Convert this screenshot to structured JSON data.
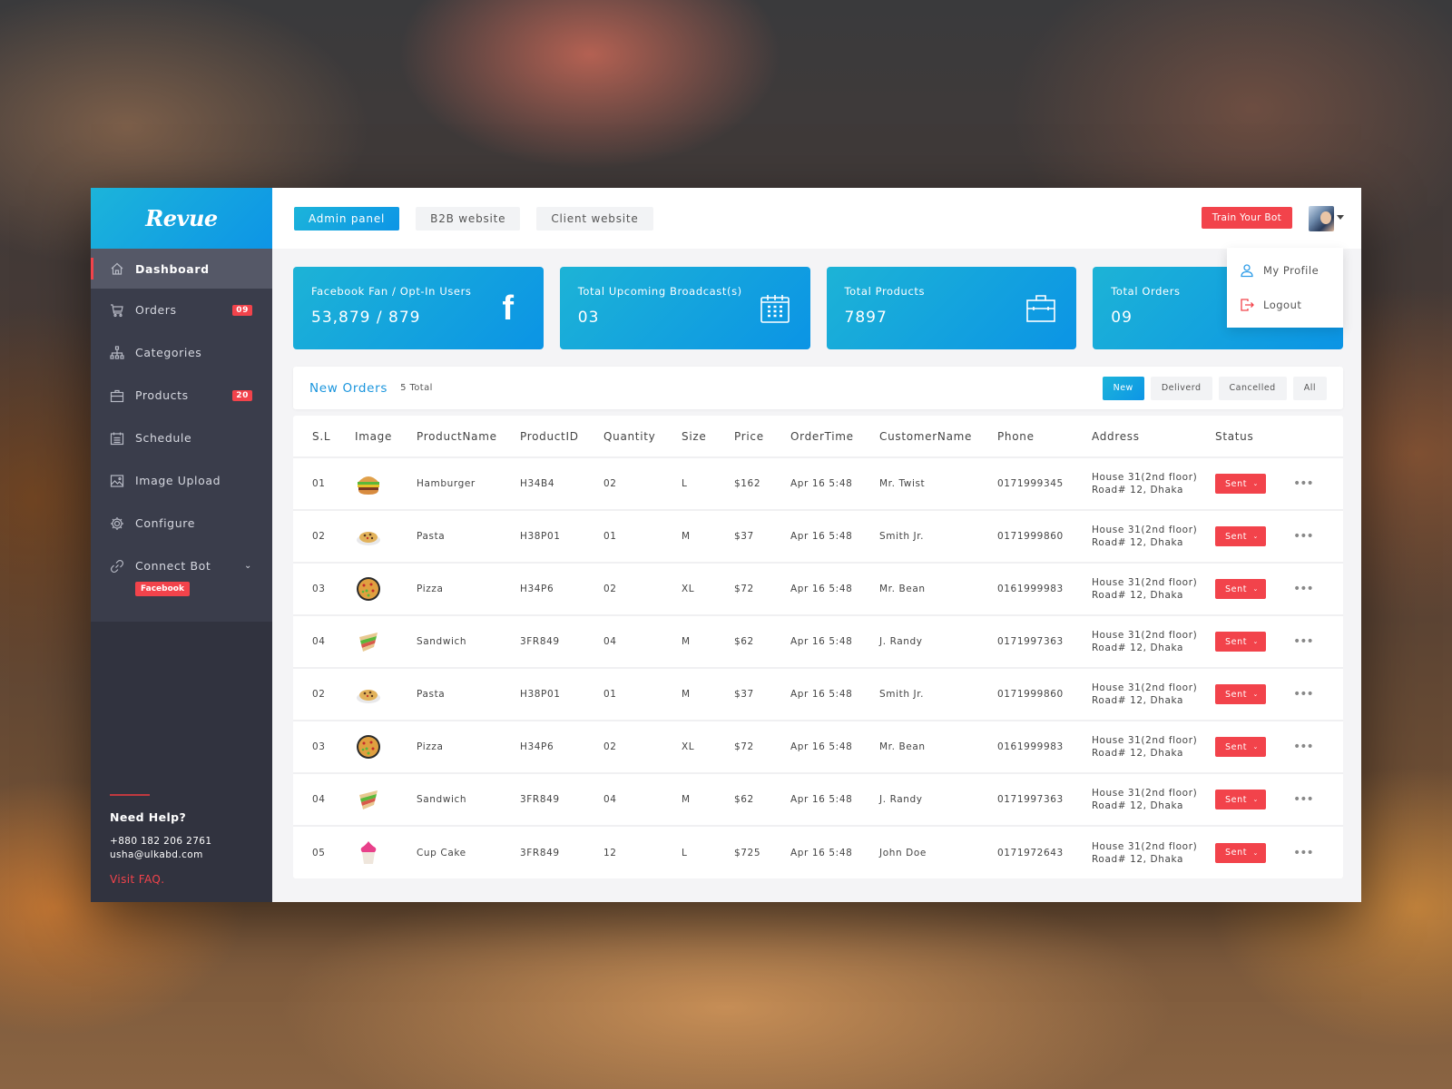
{
  "brand": {
    "name": "Revue"
  },
  "sidebar": {
    "items": [
      {
        "label": "Dashboard",
        "icon": "home-icon",
        "active": true
      },
      {
        "label": "Orders",
        "icon": "cart-icon",
        "badge": "09"
      },
      {
        "label": "Categories",
        "icon": "sitemap-icon"
      },
      {
        "label": "Products",
        "icon": "briefcase-icon",
        "badge": "20"
      },
      {
        "label": "Schedule",
        "icon": "calendar-icon"
      },
      {
        "label": "Image Upload",
        "icon": "image-icon"
      },
      {
        "label": "Configure",
        "icon": "gear-icon"
      },
      {
        "label": "Connect Bot",
        "icon": "link-icon",
        "expandable": true
      }
    ],
    "connect_bot_tag": "Facebook",
    "help": {
      "title": "Need Help?",
      "phone": "+880 182 206 2761",
      "email": "usha@ulkabd.com",
      "faq": "Visit FAQ."
    }
  },
  "topbar": {
    "tabs": [
      {
        "label": "Admin panel",
        "active": true
      },
      {
        "label": "B2B website"
      },
      {
        "label": "Client website"
      }
    ],
    "train_button": "Train Your Bot",
    "profile_menu": [
      {
        "label": "My Profile",
        "icon": "user-icon"
      },
      {
        "label": "Logout",
        "icon": "logout-icon"
      }
    ]
  },
  "stats": [
    {
      "label": "Facebook Fan / Opt-In Users",
      "value": "53,879 / 879",
      "icon": "facebook-icon"
    },
    {
      "label": "Total Upcoming Broadcast(s)",
      "value": "03",
      "icon": "calendar-icon"
    },
    {
      "label": "Total Products",
      "value": "7897",
      "icon": "briefcase-icon"
    },
    {
      "label": "Total Orders",
      "value": "09",
      "icon": "orders-icon"
    }
  ],
  "orders": {
    "title": "New Orders",
    "count": "5 Total",
    "filters": [
      {
        "label": "New",
        "active": true
      },
      {
        "label": "Deliverd"
      },
      {
        "label": "Cancelled"
      },
      {
        "label": "All"
      }
    ],
    "columns": [
      "S.L",
      "Image",
      "ProductName",
      "ProductID",
      "Quantity",
      "Size",
      "Price",
      "OrderTime",
      "CustomerName",
      "Phone",
      "Address",
      "Status"
    ],
    "rows": [
      {
        "sl": "01",
        "image": "hamburger",
        "name": "Hamburger",
        "id": "H34B4",
        "qty": "02",
        "size": "L",
        "price": "$162",
        "time": "Apr 16 5:48",
        "customer": "Mr. Twist",
        "phone": "0171999345",
        "addr1": "House 31(2nd floor)",
        "addr2": "Road# 12, Dhaka",
        "status": "Sent"
      },
      {
        "sl": "02",
        "image": "pasta",
        "name": "Pasta",
        "id": "H38P01",
        "qty": "01",
        "size": "M",
        "price": "$37",
        "time": "Apr 16 5:48",
        "customer": "Smith Jr.",
        "phone": "0171999860",
        "addr1": "House 31(2nd floor)",
        "addr2": "Road# 12, Dhaka",
        "status": "Sent"
      },
      {
        "sl": "03",
        "image": "pizza",
        "name": "Pizza",
        "id": "H34P6",
        "qty": "02",
        "size": "XL",
        "price": "$72",
        "time": "Apr 16 5:48",
        "customer": "Mr. Bean",
        "phone": "0161999983",
        "addr1": "House 31(2nd floor)",
        "addr2": "Road# 12, Dhaka",
        "status": "Sent"
      },
      {
        "sl": "04",
        "image": "sandwich",
        "name": "Sandwich",
        "id": "3FR849",
        "qty": "04",
        "size": "M",
        "price": "$62",
        "time": "Apr 16 5:48",
        "customer": "J. Randy",
        "phone": "0171997363",
        "addr1": "House 31(2nd floor)",
        "addr2": "Road# 12, Dhaka",
        "status": "Sent"
      },
      {
        "sl": "02",
        "image": "pasta",
        "name": "Pasta",
        "id": "H38P01",
        "qty": "01",
        "size": "M",
        "price": "$37",
        "time": "Apr 16 5:48",
        "customer": "Smith Jr.",
        "phone": "0171999860",
        "addr1": "House 31(2nd floor)",
        "addr2": "Road# 12, Dhaka",
        "status": "Sent"
      },
      {
        "sl": "03",
        "image": "pizza",
        "name": "Pizza",
        "id": "H34P6",
        "qty": "02",
        "size": "XL",
        "price": "$72",
        "time": "Apr 16 5:48",
        "customer": "Mr. Bean",
        "phone": "0161999983",
        "addr1": "House 31(2nd floor)",
        "addr2": "Road# 12, Dhaka",
        "status": "Sent"
      },
      {
        "sl": "04",
        "image": "sandwich",
        "name": "Sandwich",
        "id": "3FR849",
        "qty": "04",
        "size": "M",
        "price": "$62",
        "time": "Apr 16 5:48",
        "customer": "J. Randy",
        "phone": "0171997363",
        "addr1": "House 31(2nd floor)",
        "addr2": "Road# 12, Dhaka",
        "status": "Sent"
      },
      {
        "sl": "05",
        "image": "cupcake",
        "name": "Cup Cake",
        "id": "3FR849",
        "qty": "12",
        "size": "L",
        "price": "$725",
        "time": "Apr 16 5:48",
        "customer": "John Doe",
        "phone": "0171972643",
        "addr1": "House 31(2nd floor)",
        "addr2": "Road# 12, Dhaka",
        "status": "Sent"
      }
    ]
  },
  "colors": {
    "accent": "#0d95e6",
    "danger": "#f2434b",
    "sidebar": "#3a3d4b"
  }
}
